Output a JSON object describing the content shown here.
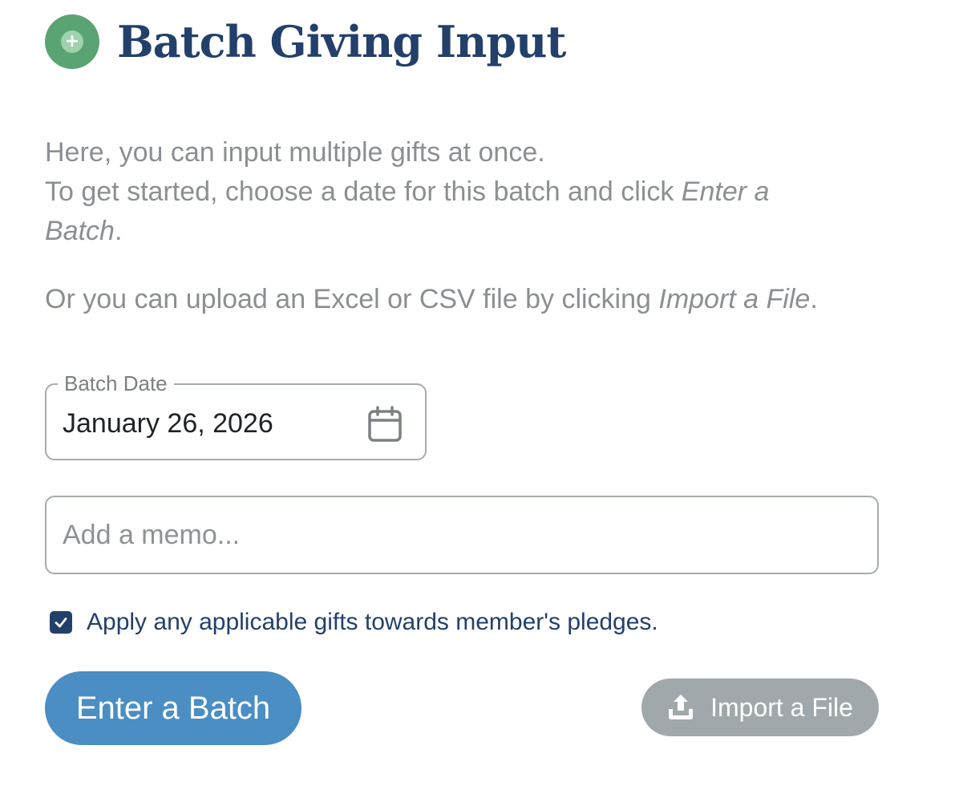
{
  "header": {
    "icon": "plus-circle-icon",
    "icon_color": "#5aa474",
    "title": "Batch Giving Input",
    "title_color": "#23406a"
  },
  "intro": {
    "line1": "Here, you can input multiple gifts at once.",
    "line2_prefix": "To get started, choose a date for this batch and click ",
    "line2_link": "Enter a Batch",
    "line2_suffix": ".",
    "line3_prefix": "Or you can upload an Excel or CSV file by clicking ",
    "line3_link": "Import a File",
    "line3_suffix": "."
  },
  "batch_date": {
    "label": "Batch Date",
    "value": "January 26, 2026",
    "icon": "calendar-icon"
  },
  "memo": {
    "placeholder": "Add a memo...",
    "value": ""
  },
  "pledge_option": {
    "checked": true,
    "label": "Apply any applicable gifts towards member's pledges."
  },
  "actions": {
    "enter_label": "Enter a Batch",
    "enter_color": "#4a8ec3",
    "import_label": "Import a File",
    "import_color": "#a1a8ab",
    "import_icon": "upload-icon"
  }
}
